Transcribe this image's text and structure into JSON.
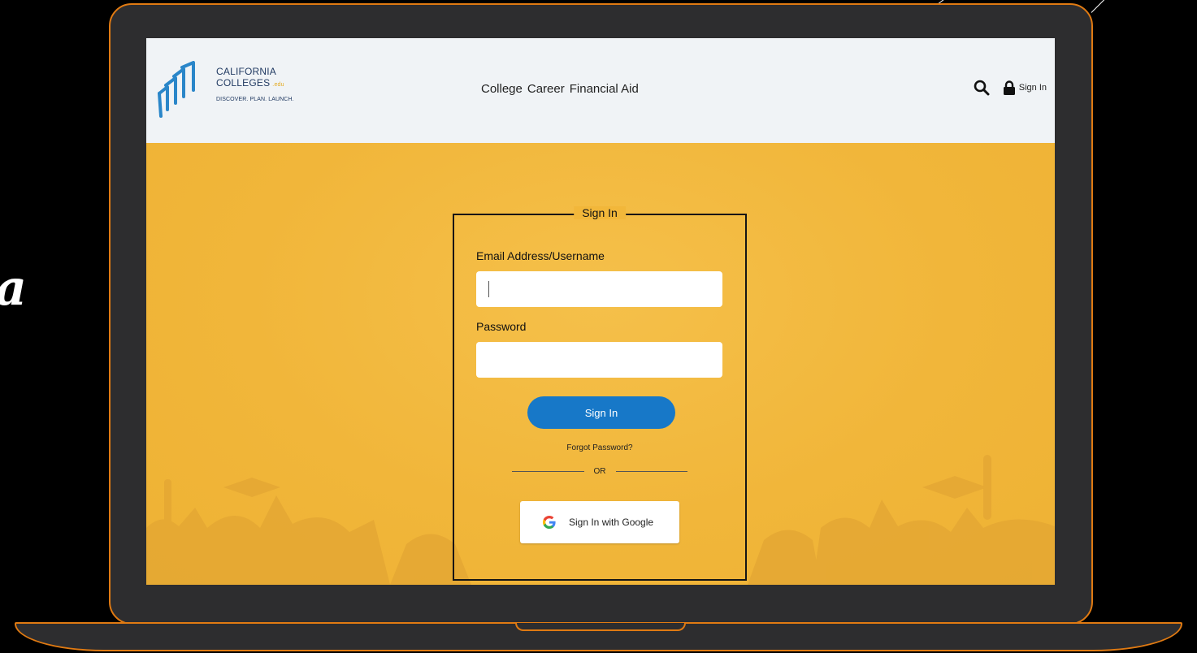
{
  "header": {
    "logo": {
      "line1": "CALIFORNIA",
      "line2": "COLLEGES",
      "suffix": ".edu",
      "tagline": "DISCOVER. PLAN. LAUNCH."
    },
    "nav": [
      "College",
      "Career",
      "Financial Aid"
    ],
    "signin_link": "Sign In",
    "icons": {
      "search": "search-icon",
      "lock": "lock-icon"
    }
  },
  "signin_form": {
    "legend": "Sign In",
    "email_label": "Email Address/Username",
    "email_value": "",
    "password_label": "Password",
    "password_value": "",
    "submit_label": "Sign In",
    "forgot_label": "Forgot Password?",
    "divider_text": "OR",
    "google_label": "Sign In with Google"
  },
  "colors": {
    "frame_accent": "#e07a12",
    "hero_bg": "#f2b73a",
    "button_blue": "#1778c8",
    "logo_navy": "#223b63"
  }
}
